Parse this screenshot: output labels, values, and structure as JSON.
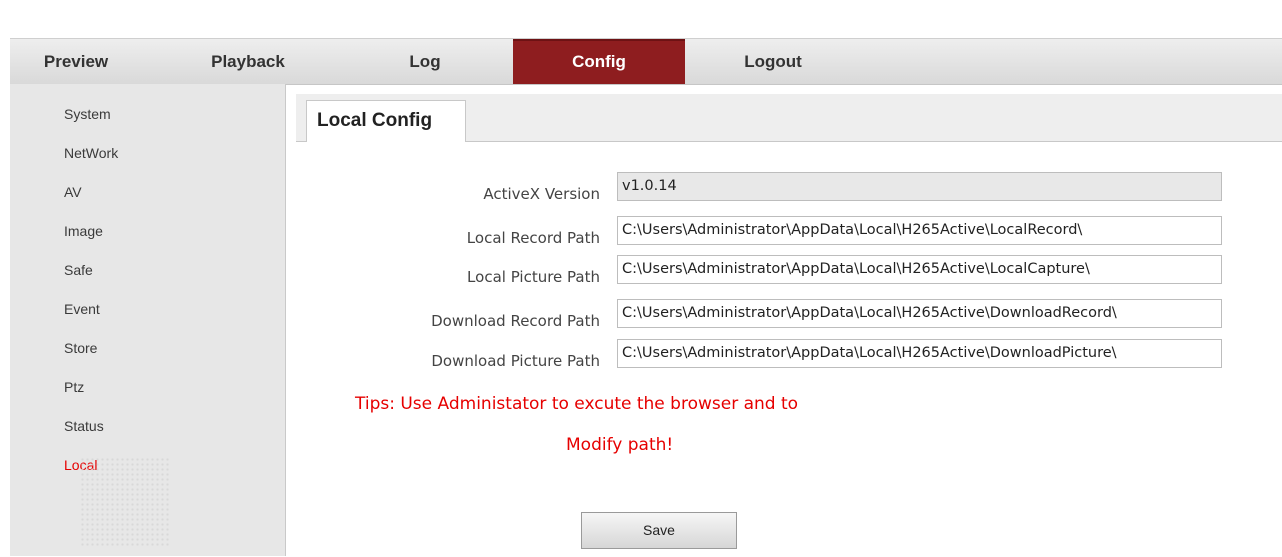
{
  "nav": {
    "preview": "Preview",
    "playback": "Playback",
    "log": "Log",
    "config": "Config",
    "logout": "Logout"
  },
  "sidebar": {
    "items": [
      "System",
      "NetWork",
      "AV",
      "Image",
      "Safe",
      "Event",
      "Store",
      "Ptz",
      "Status",
      "Local"
    ],
    "active": "Local"
  },
  "tab": {
    "label": "Local Config"
  },
  "form": {
    "activex_label": "ActiveX Version",
    "activex_value": "v1.0.14",
    "record_label": "Local Record Path",
    "record_value": "C:\\Users\\Administrator\\AppData\\Local\\H265Active\\LocalRecord\\",
    "picture_label": "Local Picture Path",
    "picture_value": "C:\\Users\\Administrator\\AppData\\Local\\H265Active\\LocalCapture\\",
    "dl_record_label": "Download Record Path",
    "dl_record_value": "C:\\Users\\Administrator\\AppData\\Local\\H265Active\\DownloadRecord\\",
    "dl_picture_label": "Download Picture Path",
    "dl_picture_value": "C:\\Users\\Administrator\\AppData\\Local\\H265Active\\DownloadPicture\\"
  },
  "tips": {
    "line1": "Tips: Use Administator to excute the browser and to",
    "line2": "Modify path!"
  },
  "save_label": "Save",
  "colors": {
    "accent": "#8e1d1f",
    "active_text": "#e60000",
    "tips": "#e60000"
  }
}
